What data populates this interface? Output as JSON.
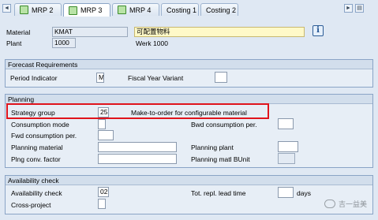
{
  "tabs": [
    {
      "label": "MRP 2",
      "icon": "check-icon"
    },
    {
      "label": "MRP 3",
      "icon": "check-icon",
      "active": true
    },
    {
      "label": "MRP 4",
      "icon": "check-icon"
    },
    {
      "label": "Costing 1"
    },
    {
      "label": "Costing 2"
    }
  ],
  "nav": {
    "prev": "◄",
    "next": "►",
    "menu": "▤"
  },
  "header": {
    "material_label": "Material",
    "material_value": "KMAT",
    "material_desc": "可配置物料",
    "plant_label": "Plant",
    "plant_value": "1000",
    "plant_name": "Werk 1000",
    "info_icon": "i"
  },
  "forecast": {
    "title": "Forecast Requirements",
    "period_indicator_label": "Period Indicator",
    "period_indicator_value": "M",
    "fiscal_year_variant_label": "Fiscal Year Variant",
    "fiscal_year_variant_value": ""
  },
  "planning": {
    "title": "Planning",
    "strategy_group_label": "Strategy group",
    "strategy_group_value": "25",
    "strategy_group_desc": "Make-to-order for configurable material",
    "consumption_mode_label": "Consumption mode",
    "bwd_consumption_label": "Bwd consumption per.",
    "fwd_consumption_label": "Fwd consumption per.",
    "planning_material_label": "Planning material",
    "planning_plant_label": "Planning plant",
    "plng_conv_factor_label": "Plng conv. factor",
    "planning_matl_bunit_label": "Planning matl BUnit"
  },
  "availability": {
    "title": "Availability check",
    "availability_check_label": "Availability check",
    "availability_check_value": "02",
    "tot_repl_lead_time_label": "Tot. repl. lead time",
    "tot_repl_lead_time_value": "",
    "days_label": "days",
    "cross_project_label": "Cross-project"
  },
  "watermark": {
    "text": "吉一益美"
  },
  "colors": {
    "highlight": "#e0141c",
    "desc_field": "#fff9c8"
  }
}
